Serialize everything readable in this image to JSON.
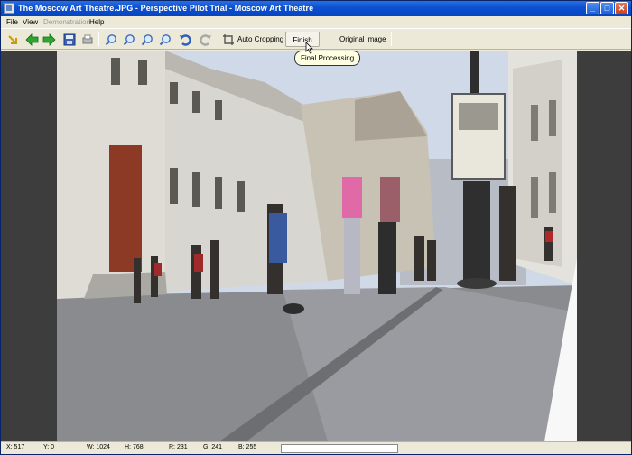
{
  "window": {
    "title": "The Moscow Art Theatre.JPG - Perspective Pilot Trial - Moscow Art Theatre",
    "minimize": "_",
    "maximize": "□",
    "close": "✕"
  },
  "menu": {
    "file": "File",
    "view": "View",
    "demonstration": "Demonstration",
    "help": "Help"
  },
  "toolbar": {
    "icons": [
      "open-icon",
      "back-arrow-icon",
      "forward-arrow-icon",
      "save-icon",
      "print-icon",
      "zoom-in-icon",
      "zoom-in-2-icon",
      "zoom-out-icon",
      "zoom-fit-icon",
      "undo-icon",
      "redo-icon",
      "auto-crop-icon"
    ],
    "auto_cropping": "Auto Cropping",
    "finish": "Finish",
    "original_image": "Original image"
  },
  "tooltip": {
    "text": "Final Processing"
  },
  "photo": {
    "description_icon": "street-photo-moscow"
  },
  "status": {
    "x": "X: 517",
    "y": "Y: 0",
    "w": "W: 1024",
    "h": "H: 768",
    "r": "R: 231",
    "g": "G: 241",
    "b": "B: 255",
    "progress_value": 0
  },
  "colors": {
    "titlebar": "#0846c0",
    "accent": "#3a8ee6"
  }
}
